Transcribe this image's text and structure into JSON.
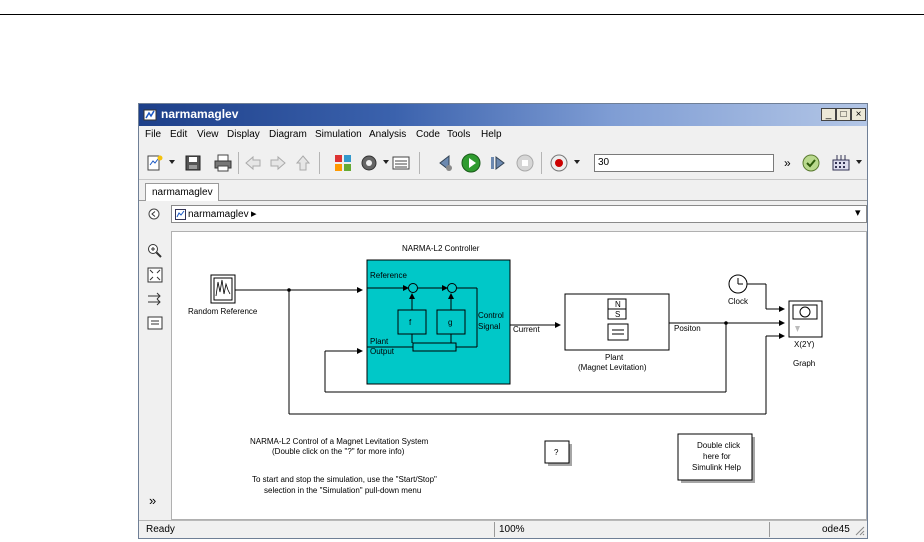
{
  "window": {
    "title": "narmamaglev"
  },
  "window_controls": {
    "minimize": "_",
    "maximize": "□",
    "close": "×"
  },
  "menu": [
    "File",
    "Edit",
    "View",
    "Display",
    "Diagram",
    "Simulation",
    "Analysis",
    "Code",
    "Tools",
    "Help"
  ],
  "toolbar": {
    "stop_time": "30",
    "more": "»"
  },
  "tabs": [
    {
      "label": "narmamaglev"
    }
  ],
  "address": {
    "path": "narmamaglev",
    "arrow": "▸",
    "dropdown": "▾"
  },
  "diagram": {
    "controller_title": "NARMA-L2 Controller",
    "controller_ports": {
      "reference": "Reference",
      "plant_output_1": "Plant",
      "plant_output_2": "Output",
      "control_1": "Control",
      "control_2": "Signal"
    },
    "f_label": "f",
    "g_label": "g",
    "random_reference": "Random Reference",
    "clock": "Clock",
    "plant_label": "Plant",
    "plant_sublabel": "(Magnet Levitation)",
    "plant_ns_n": "N",
    "plant_ns_s": "S",
    "graph_title": "X(2Y)",
    "graph_label": "Graph",
    "signal_current": "Current",
    "signal_position": "Positon",
    "help_question": "?",
    "note_title": "NARMA-L2 Control of a Magnet Levitation System",
    "note_sub": "(Double click on the \"?\" for more info)",
    "note_instr_1": "To start and stop the simulation, use the \"Start/Stop\"",
    "note_instr_2": "selection in the \"Simulation\" pull-down menu",
    "help_box": [
      "Double click",
      "here for",
      "Simulink Help"
    ]
  },
  "status": {
    "state": "Ready",
    "zoom": "100%",
    "solver": "ode45"
  },
  "colors": {
    "controller_fill": "#00c8c8",
    "title_start": "#1d3f89",
    "title_end": "#b3c6e6"
  }
}
